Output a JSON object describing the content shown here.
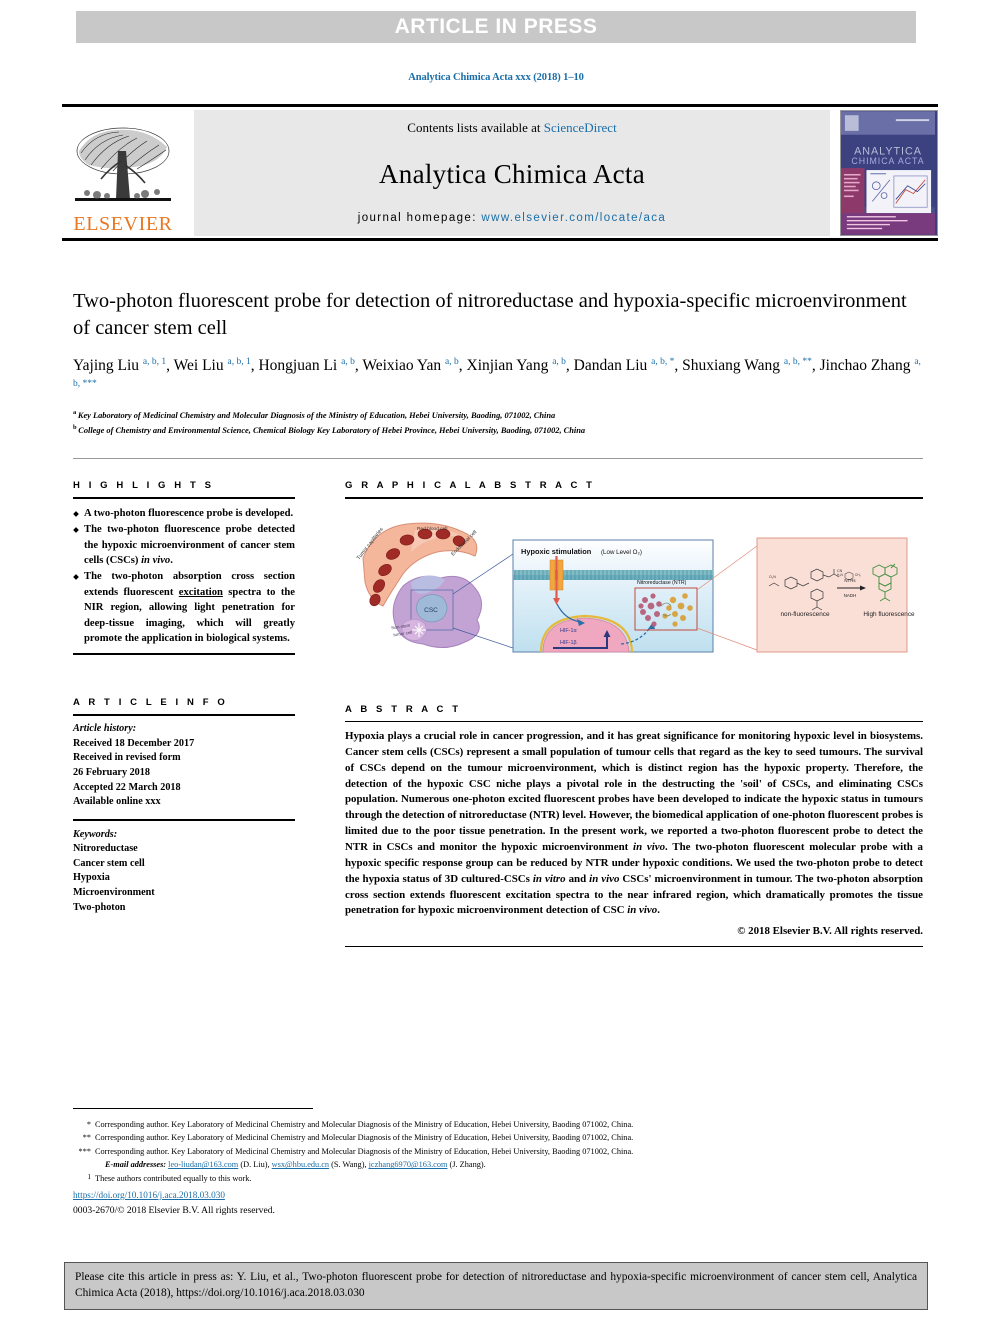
{
  "banner": {
    "text": "ARTICLE IN PRESS"
  },
  "journal_ref": "Analytica Chimica Acta xxx (2018) 1–10",
  "masthead": {
    "contents_prefix": "Contents lists available at ",
    "sciencedirect": "ScienceDirect",
    "journal_title": "Analytica Chimica Acta",
    "homepage_label": "journal homepage: ",
    "homepage_url": "www.elsevier.com/locate/aca",
    "publisher_logo_text": "ELSEVIER",
    "cover_title_line1": "ANALYTICA",
    "cover_title_line2": "CHIMICA ACTA"
  },
  "article": {
    "title": "Two-photon fluorescent probe for detection of nitroreductase and hypoxia-specific microenvironment of cancer stem cell",
    "authors": [
      {
        "name": "Yajing Liu",
        "sup": "a, b, 1"
      },
      {
        "name": "Wei Liu",
        "sup": "a, b, 1"
      },
      {
        "name": "Hongjuan Li",
        "sup": "a, b"
      },
      {
        "name": "Weixiao Yan",
        "sup": "a, b"
      },
      {
        "name": "Xinjian Yang",
        "sup": "a, b"
      },
      {
        "name": "Dandan Liu",
        "sup": "a, b, *"
      },
      {
        "name": "Shuxiang Wang",
        "sup": "a, b, **"
      },
      {
        "name": "Jinchao Zhang",
        "sup": "a, b, ***"
      }
    ],
    "affiliations": [
      {
        "mark": "a",
        "text": "Key Laboratory of Medicinal Chemistry and Molecular Diagnosis of the Ministry of Education, Hebei University, Baoding, 071002, China"
      },
      {
        "mark": "b",
        "text": "College of Chemistry and Environmental Science, Chemical Biology Key Laboratory of Hebei Province, Hebei University, Baoding, 071002, China"
      }
    ]
  },
  "highlights": {
    "heading": "H I G H L I G H T S",
    "items": [
      {
        "pre": "A two-photon fluorescence probe is developed.",
        "underline": "",
        "post": "",
        "italic": ""
      },
      {
        "pre": "The two-photon fluorescence probe detected the hypoxic microenvironment of cancer stem cells (CSCs) ",
        "italic": "in vivo",
        "post": "."
      },
      {
        "pre": "The two-photon absorption cross section extends fluorescent ",
        "underline": "excitation",
        "post": " spectra to the NIR region, allowing light penetration for deep-tissue imaging, which will greatly promote the application in biological systems."
      }
    ]
  },
  "article_info": {
    "heading": "A R T I C L E  I N F O",
    "history_label": "Article history:",
    "history": [
      "Received 18 December 2017",
      "Received in revised form",
      "26 February 2018",
      "Accepted 22 March 2018",
      "Available online xxx"
    ],
    "keywords_label": "Keywords:",
    "keywords": [
      "Nitroreductase",
      "Cancer stem cell",
      "Hypoxia",
      "Microenvironment",
      "Two-photon"
    ]
  },
  "graphical_abstract": {
    "heading": "G R A P H I C A L  A B S T R A C T",
    "labels": {
      "tumor_capillaries": "Tumor capillaries",
      "red_blood_cell": "Red blood cell",
      "endothelial_cell": "Endothelial cell",
      "csc": "CSC",
      "non_stem_tumor_cell": "Non-stem tumor cell",
      "hypoxic_stimulation": "Hypoxic stimulation",
      "low_level_o2": "(Low Level O₂)",
      "nitroreductase": "Nitroreductase (NTR)",
      "hif_1a": "HIF-1α",
      "hif_1b": "HIF-1β",
      "non_fluorescence": "non-fluorescence",
      "high_fluorescence": "High fluorescence",
      "reagent_top": "NTRs",
      "reagent_bottom": "NADH"
    }
  },
  "abstract": {
    "heading": "A B S T R A C T",
    "paragraph_1": "Hypoxia plays a crucial role in cancer progression, and it has great significance for monitoring hypoxic level in biosystems. Cancer stem cells (CSCs) represent a small population of tumour cells that regard as the key to seed tumours. The survival of CSCs depend on the tumour microenvironment, which is distinct region has the hypoxic property. Therefore, the detection of the hypoxic CSC niche plays a pivotal role in the destructing the 'soil' of CSCs, and eliminating CSCs population. Numerous one-photon excited fluorescent probes have been developed to indicate the hypoxic status in tumours through the detection of nitroreductase (NTR) level. However, the biomedical application of one-photon fluorescent probes is limited due to the poor tissue penetration. In the present work, we reported a two-photon fluorescent probe to detect the NTR in CSCs and monitor the hypoxic microenvironment ",
    "italic_1": "in vivo",
    "paragraph_2": ". The two-photon fluorescent molecular probe with a hypoxic specific response group can be reduced by NTR under hypoxic conditions. We used the two-photon probe to detect the hypoxia status of 3D cultured-CSCs ",
    "italic_2": "in vitro",
    "paragraph_3": " and ",
    "italic_3": "in vivo",
    "paragraph_4": " CSCs' microenvironment in tumour. The two-photon absorption cross section extends fluorescent excitation spectra to the near infrared region, which dramatically promotes the tissue penetration for hypoxic microenvironment detection of CSC ",
    "italic_4": "in vivo",
    "paragraph_5": ".",
    "copyright": "© 2018 Elsevier B.V. All rights reserved."
  },
  "footnotes": [
    {
      "mark": "*",
      "text": "Corresponding author. Key Laboratory of Medicinal Chemistry and Molecular Diagnosis of the Ministry of Education, Hebei University, Baoding 071002, China."
    },
    {
      "mark": "**",
      "text": "Corresponding author. Key Laboratory of Medicinal Chemistry and Molecular Diagnosis of the Ministry of Education, Hebei University, Baoding 071002, China."
    },
    {
      "mark": "***",
      "text": "Corresponding author. Key Laboratory of Medicinal Chemistry and Molecular Diagnosis of the Ministry of Education, Hebei University, Baoding 071002, China."
    }
  ],
  "emails": {
    "label": "E-mail addresses:",
    "items": [
      {
        "address": "leo-liudan@163.com",
        "owner": "(D. Liu)"
      },
      {
        "address": "wsx@hbu.edu.cn",
        "owner": "(S. Wang)"
      },
      {
        "address": "jczhang6970@163.com",
        "owner": "(J. Zhang)"
      }
    ]
  },
  "equal_contrib": {
    "mark": "1",
    "text": "These authors contributed equally to this work."
  },
  "doi": "https://doi.org/10.1016/j.aca.2018.03.030",
  "issn_line": "0003-2670/© 2018 Elsevier B.V. All rights reserved.",
  "citation_box": {
    "text": "Please cite this article in press as: Y. Liu, et al., Two-photon fluorescent probe for detection of nitroreductase and hypoxia-specific microenvironment of cancer stem cell, Analytica Chimica Acta (2018), https://doi.org/10.1016/j.aca.2018.03.030"
  },
  "colors": {
    "banner_bg": "#c8c8c8",
    "link_blue": "#1a6ea8",
    "elsevier_orange": "#e87722",
    "masthead_bg": "#e8e8e8"
  }
}
